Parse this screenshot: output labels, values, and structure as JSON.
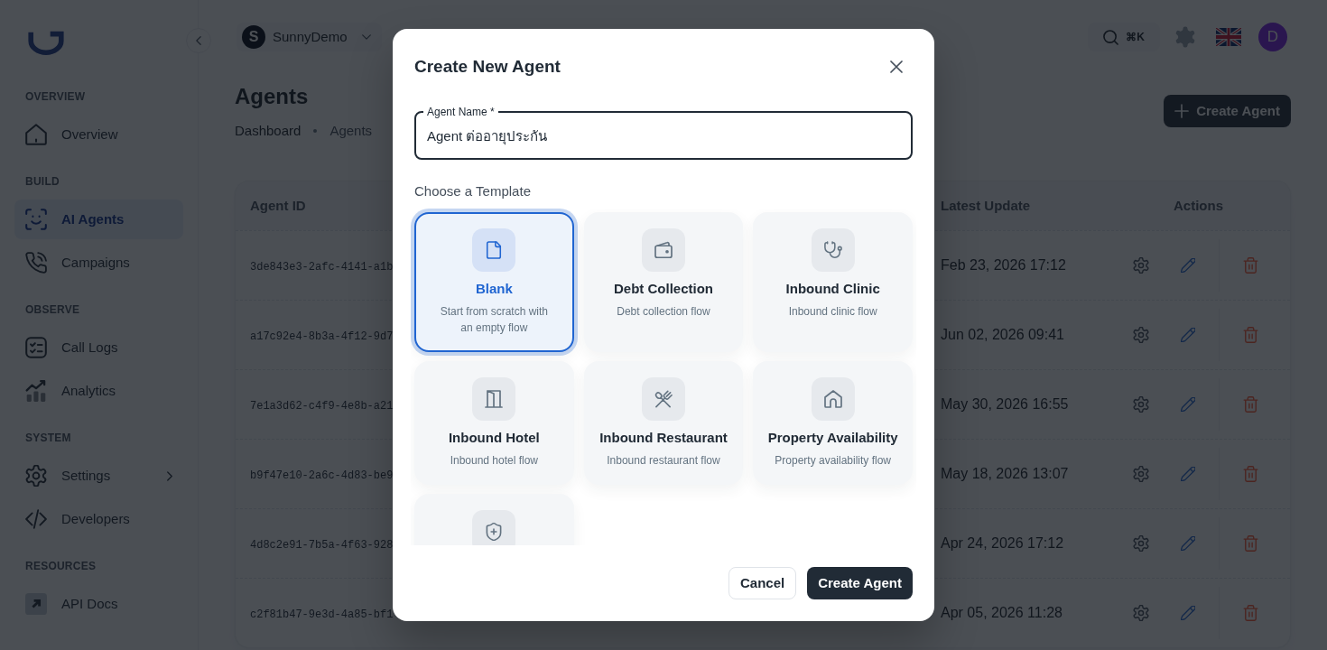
{
  "sidebar": {
    "sections": [
      {
        "heading": "OVERVIEW",
        "items": [
          {
            "label": "Overview",
            "kind": "link",
            "selected": false
          }
        ]
      },
      {
        "heading": "BUILD",
        "items": [
          {
            "label": "AI Agents",
            "kind": "link",
            "selected": true
          },
          {
            "label": "Campaigns",
            "kind": "link",
            "selected": false
          }
        ]
      },
      {
        "heading": "OBSERVE",
        "items": [
          {
            "label": "Call Logs",
            "kind": "link",
            "selected": false
          },
          {
            "label": "Analytics",
            "kind": "link",
            "selected": false
          }
        ]
      },
      {
        "heading": "SYSTEM",
        "items": [
          {
            "label": "Settings",
            "kind": "submenu",
            "selected": false
          },
          {
            "label": "Developers",
            "kind": "link",
            "selected": false
          }
        ]
      },
      {
        "heading": "RESOURCES",
        "items": [
          {
            "label": "API Docs",
            "kind": "link",
            "selected": false
          }
        ]
      }
    ]
  },
  "topbar": {
    "workspace": {
      "initial": "S",
      "name": "SunnyDemo"
    },
    "search_shortcut": "⌘K",
    "user_initial": "D"
  },
  "page": {
    "title": "Agents",
    "breadcrumbs": [
      {
        "label": "Dashboard",
        "current": false
      },
      {
        "label": "Agents",
        "current": true
      }
    ],
    "create_button": "Create Agent"
  },
  "table": {
    "columns": [
      "Agent ID",
      "Latest Update",
      "Actions"
    ],
    "rows": [
      {
        "agent_id": "3de843e3-2afc-4141-a1b",
        "latest_update": "Feb 23, 2026 17:12"
      },
      {
        "agent_id": "a17c92e4-8b3a-4f12-9d7",
        "latest_update": "Jun 02, 2026 09:41"
      },
      {
        "agent_id": "7e1a3d62-c4f9-4e8b-a21",
        "latest_update": "May 30, 2026 16:55"
      },
      {
        "agent_id": "b9f47e10-2a6c-4d83-be9",
        "latest_update": "May 18, 2026 13:07"
      },
      {
        "agent_id": "4d8c2e91-7b5a-4f63-928",
        "latest_update": "Apr 24, 2026 17:12"
      },
      {
        "agent_id": "c2f81b47-9e3d-4a85-bf1",
        "latest_update": "Apr 05, 2026 11:28"
      }
    ]
  },
  "dialog": {
    "title": "Create New Agent",
    "name_field": {
      "label": "Agent Name *",
      "value": "Agent ต่ออายุประกัน"
    },
    "templates_label": "Choose a Template",
    "templates": [
      {
        "title": "Blank",
        "description": "Start from scratch with an empty flow",
        "selected": true
      },
      {
        "title": "Debt Collection",
        "description": "Debt collection flow",
        "selected": false
      },
      {
        "title": "Inbound Clinic",
        "description": "Inbound clinic flow",
        "selected": false
      },
      {
        "title": "Inbound Hotel",
        "description": "Inbound hotel flow",
        "selected": false
      },
      {
        "title": "Inbound Restaurant",
        "description": "Inbound restaurant flow",
        "selected": false
      },
      {
        "title": "Property Availability",
        "description": "Property availability flow",
        "selected": false
      },
      {
        "selected": false
      }
    ],
    "buttons": [
      {
        "label": "Cancel",
        "kind": "secondary"
      },
      {
        "label": "Create Agent",
        "kind": "primary"
      }
    ]
  }
}
